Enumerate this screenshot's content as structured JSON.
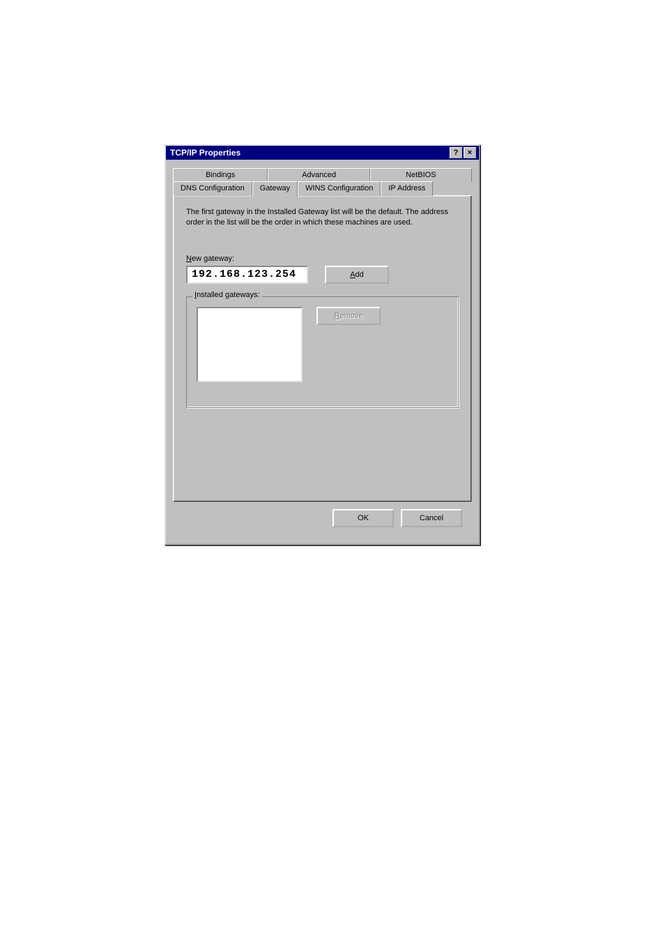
{
  "window": {
    "title": "TCP/IP Properties",
    "help_icon": "?",
    "close_icon": "×"
  },
  "tabs": {
    "row1": {
      "bindings": "Bindings",
      "advanced": "Advanced",
      "netbios": "NetBIOS"
    },
    "row2": {
      "dns": "DNS Configuration",
      "gateway": "Gateway",
      "wins": "WINS Configuration",
      "ip": "IP Address"
    }
  },
  "content": {
    "description": "The first gateway in the Installed Gateway list will be the default. The address order in the list will be the order in which these machines are used.",
    "new_gateway_label_prefix": "N",
    "new_gateway_label_rest": "ew gateway:",
    "new_gateway_value": "192.168.123.254",
    "add_prefix": "A",
    "add_rest": "dd",
    "installed_label_prefix": "I",
    "installed_label_rest": "nstalled gateways:",
    "remove_prefix": "R",
    "remove_rest": "emove"
  },
  "footer": {
    "ok": "OK",
    "cancel": "Cancel"
  }
}
